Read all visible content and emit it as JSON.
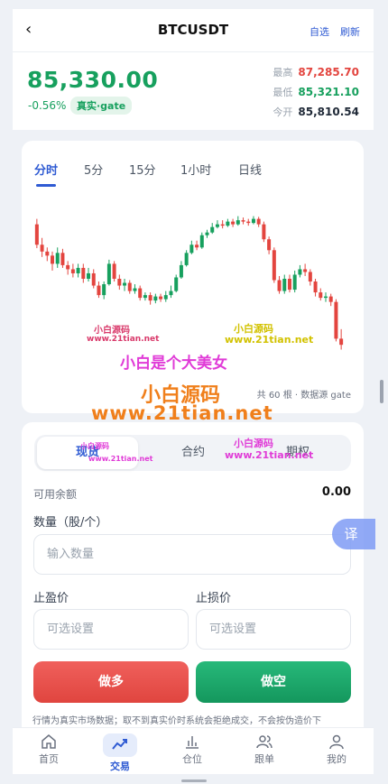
{
  "header": {
    "back_icon": "chevron-left-icon",
    "title": "BTCUSDT",
    "favorite_label": "自选",
    "refresh_label": "刷新"
  },
  "quote": {
    "price": "85,330.00",
    "change": "-0.56%",
    "source_badge": "真实·gate",
    "high_label": "最高",
    "high_value": "87,285.70",
    "low_label": "最低",
    "low_value": "85,321.10",
    "open_label": "今开",
    "open_value": "85,810.54",
    "colors": {
      "up": "#17a05e",
      "down": "#e3453f",
      "accent": "#2f5bd3"
    }
  },
  "chart": {
    "tabs": [
      "分时",
      "5分",
      "15分",
      "1小时",
      "日线"
    ],
    "active_tab": "分时",
    "note": "共 60 根 · 数据源 gate"
  },
  "chart_data": {
    "type": "candlestick",
    "count": 60,
    "ylim": [
      85200,
      87400
    ],
    "candles": [
      {
        "o": 87100,
        "c": 86800,
        "h": 87180,
        "l": 86750
      },
      {
        "o": 86800,
        "c": 86700,
        "h": 86900,
        "l": 86620
      },
      {
        "o": 86700,
        "c": 86640,
        "h": 86760,
        "l": 86560
      },
      {
        "o": 86640,
        "c": 86520,
        "h": 86700,
        "l": 86420
      },
      {
        "o": 86520,
        "c": 86680,
        "h": 86760,
        "l": 86460
      },
      {
        "o": 86680,
        "c": 86500,
        "h": 86740,
        "l": 86460
      },
      {
        "o": 86500,
        "c": 86440,
        "h": 86560,
        "l": 86360
      },
      {
        "o": 86440,
        "c": 86380,
        "h": 86520,
        "l": 86320
      },
      {
        "o": 86380,
        "c": 86460,
        "h": 86520,
        "l": 86320
      },
      {
        "o": 86460,
        "c": 86300,
        "h": 86520,
        "l": 86240
      },
      {
        "o": 86300,
        "c": 86380,
        "h": 86460,
        "l": 86260
      },
      {
        "o": 86380,
        "c": 86200,
        "h": 86440,
        "l": 86160
      },
      {
        "o": 86200,
        "c": 86060,
        "h": 86260,
        "l": 86020
      },
      {
        "o": 86060,
        "c": 86220,
        "h": 86260,
        "l": 86000
      },
      {
        "o": 86220,
        "c": 86520,
        "h": 86580,
        "l": 86200
      },
      {
        "o": 86520,
        "c": 86300,
        "h": 86560,
        "l": 86260
      },
      {
        "o": 86300,
        "c": 86200,
        "h": 86360,
        "l": 86140
      },
      {
        "o": 86200,
        "c": 86240,
        "h": 86300,
        "l": 86120
      },
      {
        "o": 86240,
        "c": 86120,
        "h": 86280,
        "l": 86080
      },
      {
        "o": 86120,
        "c": 86160,
        "h": 86220,
        "l": 86080
      },
      {
        "o": 86160,
        "c": 86020,
        "h": 86200,
        "l": 85980
      },
      {
        "o": 86020,
        "c": 86060,
        "h": 86100,
        "l": 85980
      },
      {
        "o": 86060,
        "c": 85980,
        "h": 86100,
        "l": 85920
      },
      {
        "o": 85980,
        "c": 86040,
        "h": 86080,
        "l": 85940
      },
      {
        "o": 86040,
        "c": 86000,
        "h": 86080,
        "l": 85960
      },
      {
        "o": 86000,
        "c": 86060,
        "h": 86120,
        "l": 85960
      },
      {
        "o": 86060,
        "c": 86120,
        "h": 86200,
        "l": 86020
      },
      {
        "o": 86120,
        "c": 86320,
        "h": 86360,
        "l": 86100
      },
      {
        "o": 86320,
        "c": 86500,
        "h": 86560,
        "l": 86300
      },
      {
        "o": 86500,
        "c": 86680,
        "h": 86720,
        "l": 86480
      },
      {
        "o": 86680,
        "c": 86800,
        "h": 86860,
        "l": 86660
      },
      {
        "o": 86800,
        "c": 86760,
        "h": 86860,
        "l": 86720
      },
      {
        "o": 86760,
        "c": 86940,
        "h": 86980,
        "l": 86740
      },
      {
        "o": 86940,
        "c": 86980,
        "h": 87020,
        "l": 86900
      },
      {
        "o": 86980,
        "c": 87060,
        "h": 87120,
        "l": 86960
      },
      {
        "o": 87060,
        "c": 87100,
        "h": 87160,
        "l": 87040
      },
      {
        "o": 87100,
        "c": 87080,
        "h": 87160,
        "l": 87040
      },
      {
        "o": 87080,
        "c": 87140,
        "h": 87180,
        "l": 87060
      },
      {
        "o": 87140,
        "c": 87100,
        "h": 87180,
        "l": 87060
      },
      {
        "o": 87100,
        "c": 87160,
        "h": 87220,
        "l": 87080
      },
      {
        "o": 87160,
        "c": 87140,
        "h": 87200,
        "l": 87100
      },
      {
        "o": 87140,
        "c": 87120,
        "h": 87180,
        "l": 87080
      },
      {
        "o": 87120,
        "c": 87180,
        "h": 87220,
        "l": 87100
      },
      {
        "o": 87180,
        "c": 87100,
        "h": 87210,
        "l": 87060
      },
      {
        "o": 87100,
        "c": 86880,
        "h": 87140,
        "l": 86840
      },
      {
        "o": 86880,
        "c": 86720,
        "h": 86920,
        "l": 86660
      },
      {
        "o": 86720,
        "c": 86280,
        "h": 86760,
        "l": 86240
      },
      {
        "o": 86280,
        "c": 86120,
        "h": 86340,
        "l": 86080
      },
      {
        "o": 86120,
        "c": 86300,
        "h": 86360,
        "l": 86080
      },
      {
        "o": 86300,
        "c": 86140,
        "h": 86360,
        "l": 86100
      },
      {
        "o": 86140,
        "c": 86360,
        "h": 86420,
        "l": 86100
      },
      {
        "o": 86360,
        "c": 86440,
        "h": 86500,
        "l": 86320
      },
      {
        "o": 86440,
        "c": 86400,
        "h": 86520,
        "l": 86340
      },
      {
        "o": 86400,
        "c": 86260,
        "h": 86440,
        "l": 86200
      },
      {
        "o": 86260,
        "c": 86100,
        "h": 86300,
        "l": 86040
      },
      {
        "o": 86100,
        "c": 86020,
        "h": 86160,
        "l": 85980
      },
      {
        "o": 86020,
        "c": 86040,
        "h": 86100,
        "l": 85960
      },
      {
        "o": 86040,
        "c": 85960,
        "h": 86080,
        "l": 85900
      },
      {
        "o": 85960,
        "c": 85420,
        "h": 86000,
        "l": 85380
      },
      {
        "o": 85420,
        "c": 85330,
        "h": 85560,
        "l": 85260
      }
    ]
  },
  "watermarks": {
    "wm1": "小白源码",
    "wm1_url": "www.21tian.net",
    "wm2": "小白源码",
    "wm2_url": "www.21tian.net",
    "wm3": "小白是个大美女",
    "wm4": "小白源码",
    "wm4_url": "www.21tian.net",
    "wm5": "小白源码",
    "wm5_url": "www.21tian.net",
    "wm6": "小白源码",
    "wm6_url": "www.21tian.net"
  },
  "trade": {
    "segments": [
      "现货",
      "合约",
      "期权"
    ],
    "active_segment": "现货",
    "balance_label": "可用余额",
    "balance_value": "0.00",
    "qty_label": "数量（股/个）",
    "qty_placeholder": "输入数量",
    "tp_label": "止盈价",
    "tp_placeholder": "可选设置",
    "sl_label": "止损价",
    "sl_placeholder": "可选设置",
    "long_label": "做多",
    "short_label": "做空",
    "disclaimer": "行情为真实市场数据；取不到真实价时系统会拒绝成交，不会按伪造价下"
  },
  "translate_label": "译",
  "tabbar": [
    {
      "label": "首页",
      "icon": "home-icon"
    },
    {
      "label": "交易",
      "icon": "trend-icon"
    },
    {
      "label": "仓位",
      "icon": "bar-chart-icon"
    },
    {
      "label": "跟单",
      "icon": "users-icon"
    },
    {
      "label": "我的",
      "icon": "user-icon"
    }
  ]
}
